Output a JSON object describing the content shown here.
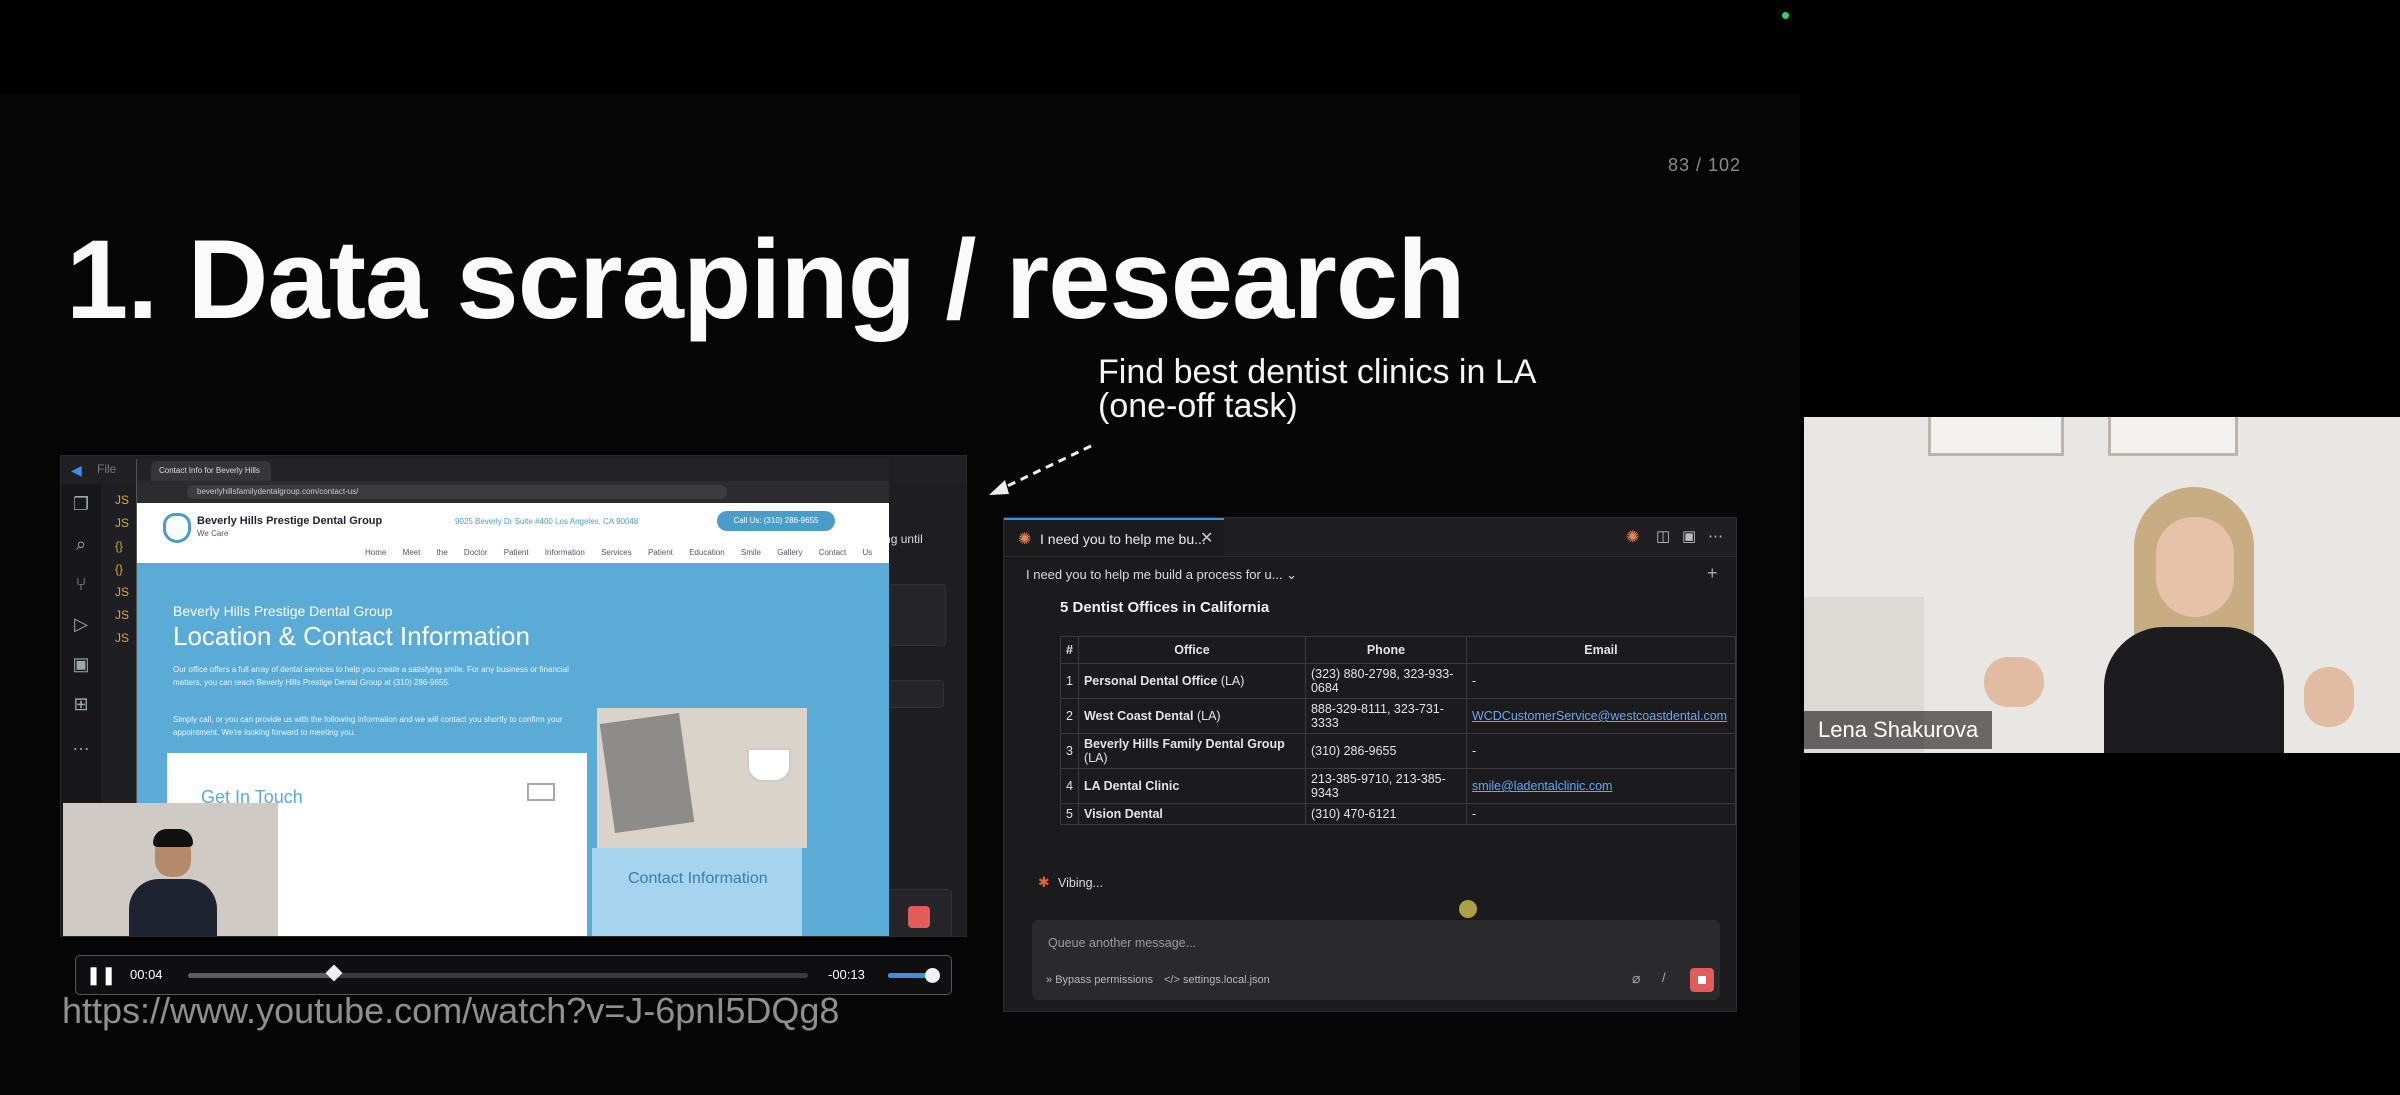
{
  "slide": {
    "page_counter": "83 / 102",
    "title": "1. Data scraping / research",
    "annotation_line1": "Find best dentist clinics in LA",
    "annotation_line2": "(one-off task)",
    "video_url": "https://www.youtube.com/watch?v=J-6pnI5DQg8"
  },
  "video": {
    "editor_menu": "File",
    "browser_tab": "Contact Info for Beverly Hills P...",
    "browser_url": "beverlyhillsfamilydentalgroup.com/contact-us/",
    "site_name": "Beverly Hills Prestige Dental Group",
    "site_tagline": "We Care",
    "site_address": "9025 Beverly Dr Suite #400 Los Angeles, CA 90048",
    "site_call": "Call Us: (310) 286-9655",
    "site_nav": "Home  Meet the Doctor  Patient Information  Services  Patient Education  Smile Gallery  Contact Us",
    "hero_subtitle": "Beverly Hills Prestige Dental Group",
    "hero_title": "Location & Contact Information",
    "hero_para1": "Our office offers a full array of dental services to help you create a satisfying smile. For any business or financial matters, you can reach Beverly Hills Prestige Dental Group at (310) 286-9655.",
    "hero_para2": "Simply call, or you can provide us with the following information and we will contact you shortly to confirm your appointment. We're looking forward to meeting you.",
    "card_title": "Get In Touch",
    "contact_box": "Contact Information",
    "side_text": "nd keep going until",
    "side_file": ".js",
    "current_time": "00:04",
    "remaining_time": "-00:13",
    "progress": 0.235,
    "volume": 0.85
  },
  "chat": {
    "tab_label": "I need you to help me bu...",
    "header_title": "I need you to help me build a process for u...",
    "table_title": "5 Dentist Offices in California",
    "columns": [
      "#",
      "Office",
      "Phone",
      "Email"
    ],
    "rows": [
      {
        "num": "1",
        "office": "Personal Dental Office",
        "city": "(LA)",
        "phone": "(323) 880-2798, 323-933-0684",
        "email": "-"
      },
      {
        "num": "2",
        "office": "West Coast Dental",
        "city": "(LA)",
        "phone": "888-329-8111, 323-731-3333",
        "email": "WCDCustomerService@westcoastdental.com"
      },
      {
        "num": "3",
        "office": "Beverly Hills Family Dental Group",
        "city": "(LA)",
        "phone": "(310) 286-9655",
        "email": "-"
      },
      {
        "num": "4",
        "office": "LA Dental Clinic",
        "city": "",
        "phone": "213-385-9710, 213-385-9343",
        "email": "smile@ladentalclinic.com"
      },
      {
        "num": "5",
        "office": "Vision Dental",
        "city": "",
        "phone": "(310) 470-6121",
        "email": "-"
      }
    ],
    "status": "Vibing...",
    "composer_placeholder": "Queue another message...",
    "bypass_label": "Bypass permissions",
    "settings_label": "settings.local.json"
  },
  "webcam": {
    "name": "Lena Shakurova"
  },
  "icons": {
    "spark": "claude-spark-icon",
    "close": "close-icon",
    "pause": "pause-icon",
    "attach": "paperclip-icon"
  },
  "colors": {
    "accent": "#3b8ee8",
    "stop": "#e35b5b",
    "link": "#6aa7ef",
    "site_blue": "#5aabd6"
  }
}
